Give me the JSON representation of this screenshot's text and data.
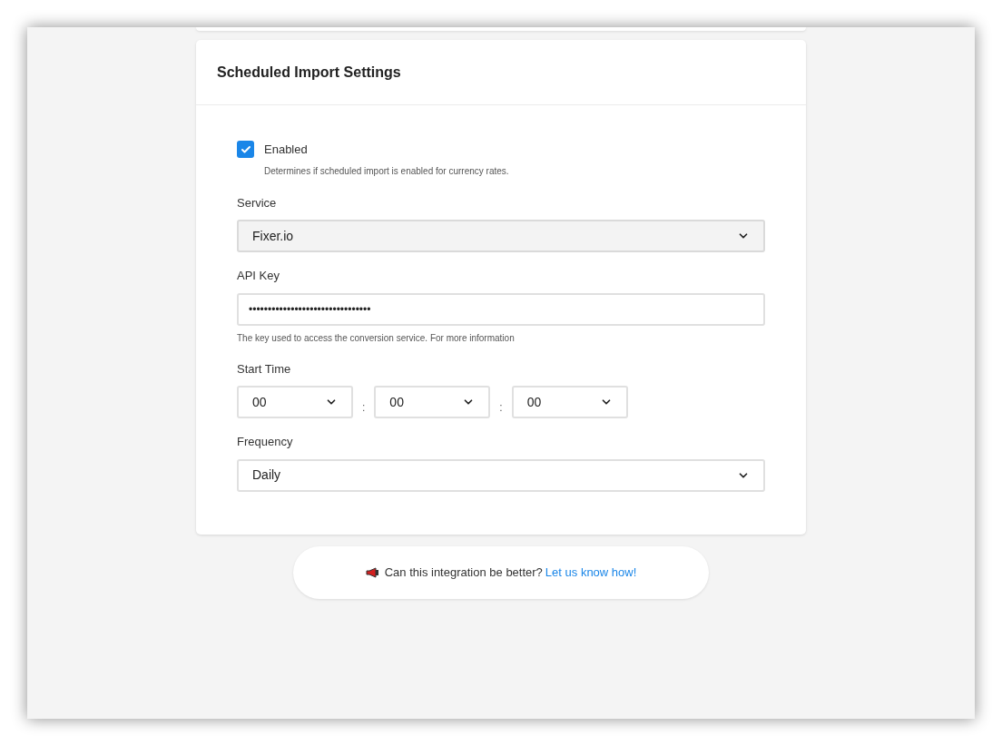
{
  "card": {
    "title": "Scheduled Import Settings"
  },
  "enabled": {
    "label": "Enabled",
    "checked": true,
    "help": "Determines if scheduled import is enabled for currency rates."
  },
  "service": {
    "label": "Service",
    "value": "Fixer.io",
    "disabled": true
  },
  "api_key": {
    "label": "API Key",
    "value": "••••••••••••••••••••••••••••••••",
    "help": "The key used to access the conversion service. For more information"
  },
  "start_time": {
    "label": "Start Time",
    "parts": [
      {
        "value": "00"
      },
      {
        "value": "00"
      },
      {
        "value": "00"
      }
    ],
    "separator": ":"
  },
  "frequency": {
    "label": "Frequency",
    "value": "Daily"
  },
  "feedback": {
    "text": "Can this integration be better?",
    "link": "Let us know how!"
  }
}
